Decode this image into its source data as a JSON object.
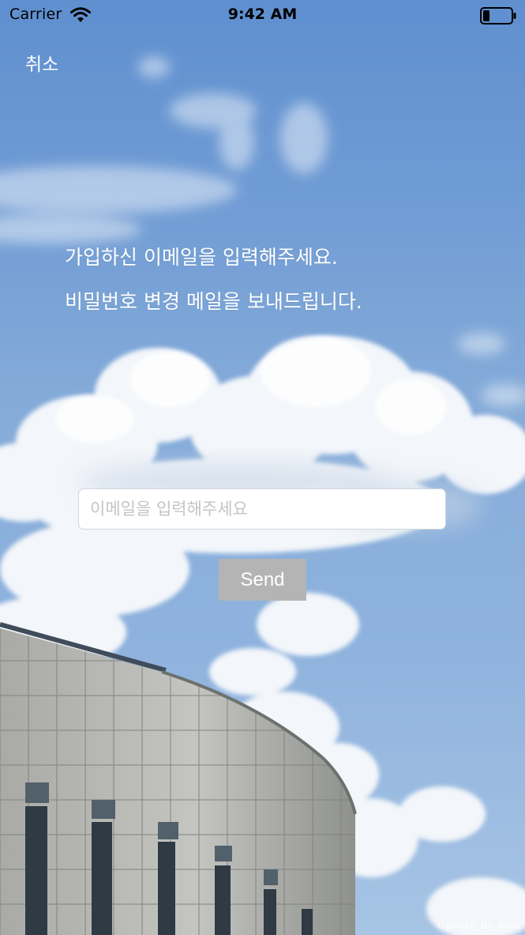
{
  "status_bar": {
    "carrier": "Carrier",
    "time": "9:42 AM",
    "icons": [
      "wifi-icon",
      "battery-icon"
    ]
  },
  "nav": {
    "cancel_label": "취소"
  },
  "instruction": {
    "line1": "가입하신 이메일을 입력해주세요.",
    "line2": "비밀번호 변경 메일을 보내드립니다."
  },
  "email": {
    "value": "",
    "placeholder": "이메일을 입력해주세요"
  },
  "send_button": {
    "label": "Send"
  },
  "watermark": "©photo_by_kykc",
  "colors": {
    "sky": "#6f9bd4",
    "text": "#ffffff",
    "send_button_bg": "#b4b4b4",
    "input_bg": "#ffffff",
    "placeholder": "#c4c4c8"
  }
}
